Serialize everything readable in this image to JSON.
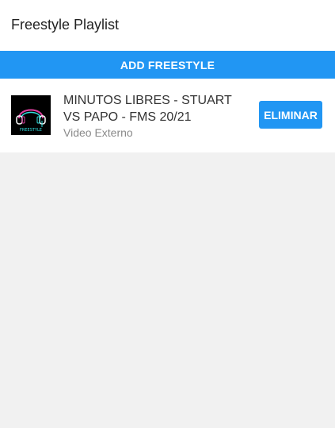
{
  "header": {
    "title": "Freestyle Playlist"
  },
  "toolbar": {
    "add_label": "ADD FREESTYLE"
  },
  "playlist": {
    "items": [
      {
        "title": "MINUTOS LIBRES - STUART VS PAPO - FMS 20/21",
        "subtitle": "Video Externo",
        "thumbnail_icon": "headphones-freestyle-logo",
        "thumbnail_text": "FREESTYLE",
        "delete_label": "ELIMINAR"
      }
    ]
  },
  "colors": {
    "accent": "#2196f3",
    "background": "#f1f1f1",
    "surface": "#ffffff",
    "logo_pink": "#e040a0",
    "logo_cyan": "#30e0e0"
  }
}
